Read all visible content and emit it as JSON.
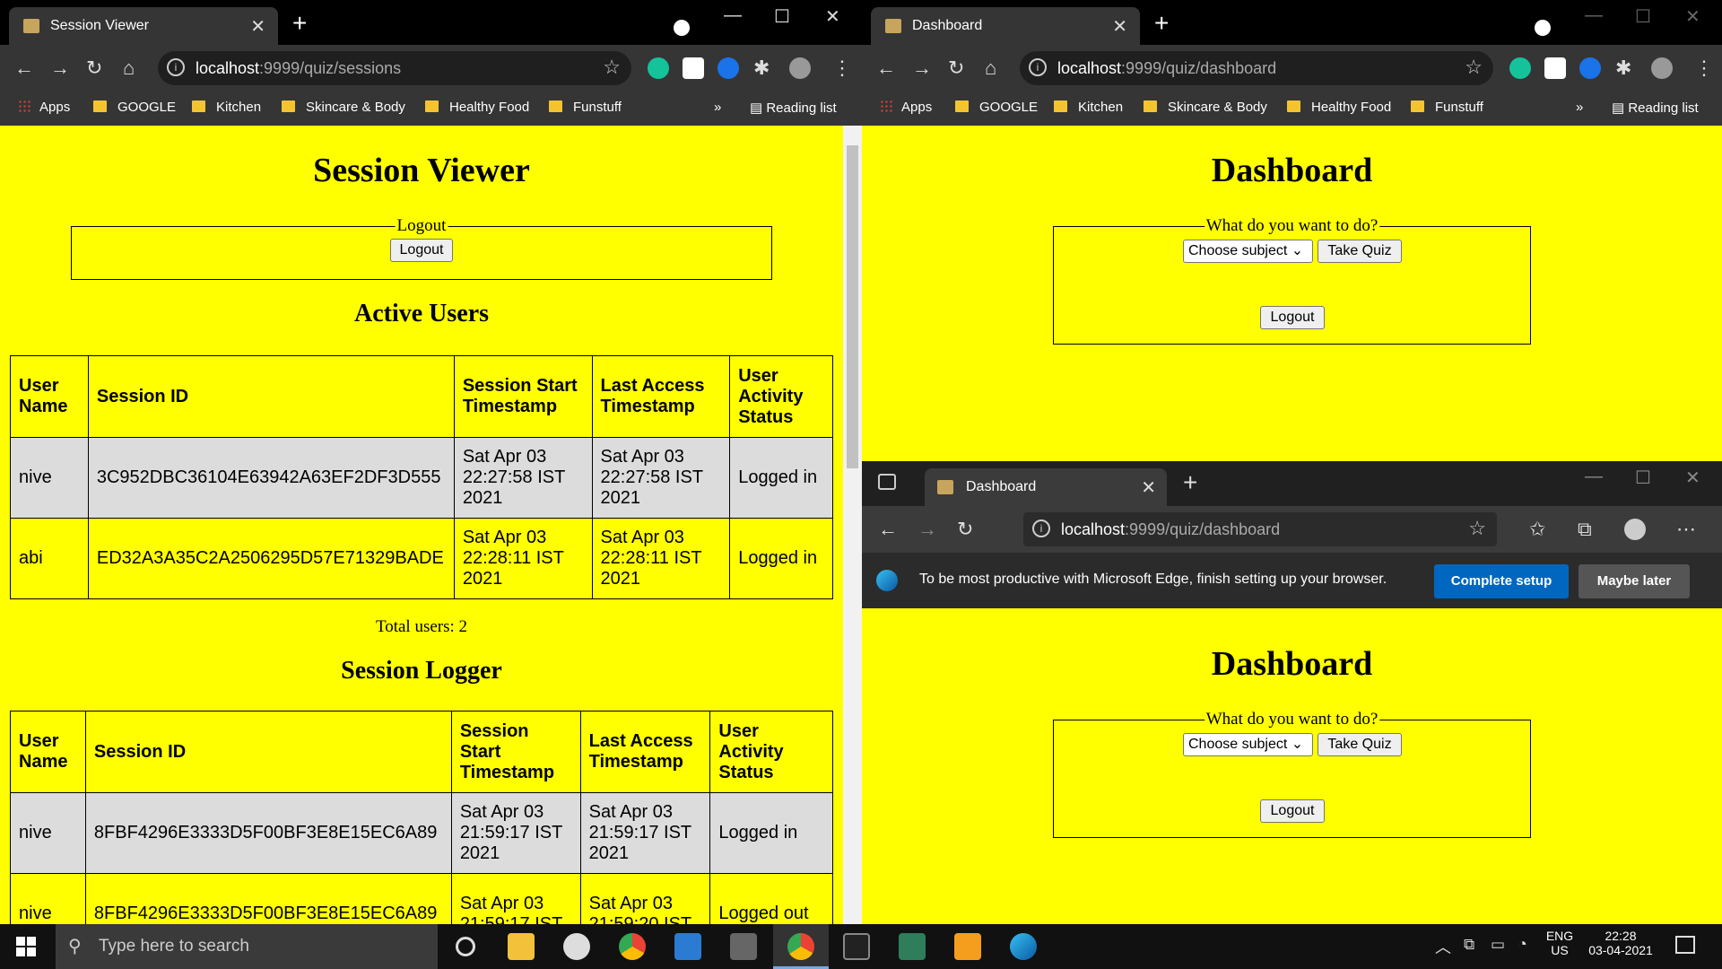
{
  "left_browser": {
    "tab_title": "Session Viewer",
    "url_host": "localhost",
    "url_path": ":9999/quiz/sessions",
    "bookmarks": [
      "Apps",
      "GOOGLE",
      "Kitchen",
      "Skincare & Body",
      "Healthy Food",
      "Funstuff"
    ],
    "reading_list": "Reading list",
    "page": {
      "title": "Session Viewer",
      "logout_legend": "Logout",
      "logout_button": "Logout",
      "active_users_heading": "Active Users",
      "active_users_headers": [
        "User Name",
        "Session ID",
        "Session Start Timestamp",
        "Last Access Timestamp",
        "User Activity Status"
      ],
      "active_users_rows": [
        [
          "nive",
          "3C952DBC36104E63942A63EF2DF3D555",
          "Sat Apr 03 22:27:58 IST 2021",
          "Sat Apr 03 22:27:58 IST 2021",
          "Logged in"
        ],
        [
          "abi",
          "ED32A3A35C2A2506295D57E71329BADE",
          "Sat Apr 03 22:28:11 IST 2021",
          "Sat Apr 03 22:28:11 IST 2021",
          "Logged in"
        ]
      ],
      "total_users": "Total users: 2",
      "session_logger_heading": "Session Logger",
      "logger_headers": [
        "User Name",
        "Session ID",
        "Session Start Timestamp",
        "Last Access Timestamp",
        "User Activity Status"
      ],
      "logger_rows": [
        [
          "nive",
          "8FBF4296E3333D5F00BF3E8E15EC6A89",
          "Sat Apr 03 21:59:17 IST 2021",
          "Sat Apr 03 21:59:17 IST 2021",
          "Logged in"
        ],
        [
          "nive",
          "8FBF4296E3333D5F00BF3E8E15EC6A89",
          "Sat Apr 03 21:59:17 IST",
          "Sat Apr 03 21:59:20 IST",
          "Logged out"
        ]
      ]
    }
  },
  "right_browser": {
    "tab_title": "Dashboard",
    "url_host": "localhost",
    "url_path": ":9999/quiz/dashboard",
    "bookmarks": [
      "Apps",
      "GOOGLE",
      "Kitchen",
      "Skincare & Body",
      "Healthy Food",
      "Funstuff"
    ],
    "reading_list": "Reading list",
    "page": {
      "title": "Dashboard",
      "legend": "What do you want to do?",
      "select_value": "Choose subject",
      "take_quiz": "Take Quiz",
      "logout": "Logout"
    }
  },
  "edge_browser": {
    "tab_title": "Dashboard",
    "url_host": "localhost",
    "url_path": ":9999/quiz/dashboard",
    "info_message": "To be most productive with Microsoft Edge, finish setting up your browser.",
    "complete_setup": "Complete setup",
    "maybe_later": "Maybe later",
    "page": {
      "title": "Dashboard",
      "legend": "What do you want to do?",
      "select_value": "Choose subject",
      "take_quiz": "Take Quiz",
      "logout": "Logout"
    }
  },
  "taskbar": {
    "search_placeholder": "Type here to search",
    "lang_top": "ENG",
    "lang_bottom": "US",
    "time": "22:28",
    "date": "03-04-2021"
  },
  "colors": {
    "page_bg": "#ffff00",
    "grey_row": "#dcdcdc",
    "edge_primary": "#0067c0"
  }
}
